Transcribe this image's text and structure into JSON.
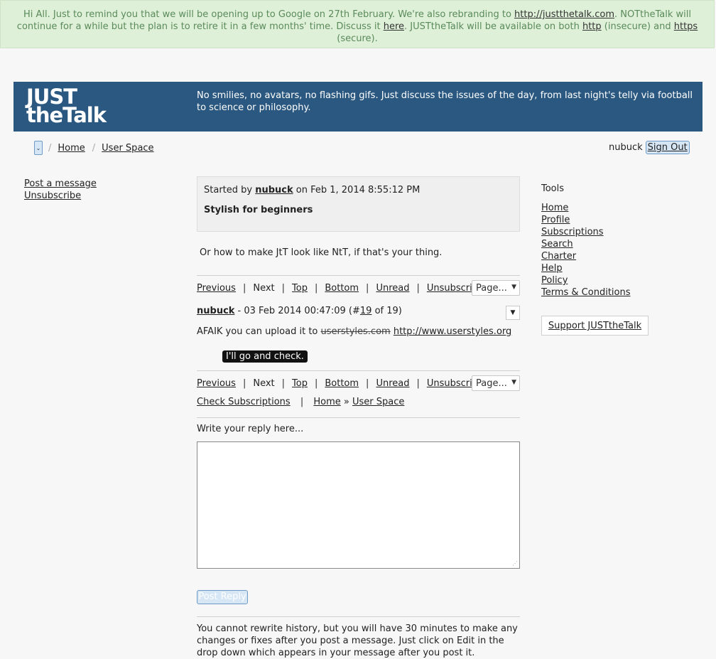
{
  "notice": {
    "text1": "Hi All. Just to remind you that we will be opening up to Google on 27th February. We're also rebranding to ",
    "link1": "http://justthetalk.com",
    "text2": ". NOTtheTalk will continue for a while but the plan is to retire it in a few months' time. Discuss it ",
    "link2": "here",
    "text3": ". JUSTtheTalk will be available on both ",
    "link3": "http",
    "text4": " (insecure) and ",
    "link4": "https",
    "text5": " (secure)."
  },
  "banner": {
    "logo_line1": "JUST",
    "logo_line2": "theTalk",
    "tagline": "No smilies, no avatars, no flashing gifs. Just discuss the issues of the day, from last night's telly via football to science or philosophy."
  },
  "breadcrumb": {
    "toggle": "⌄",
    "sep": "/",
    "home": "Home",
    "user_space": "User Space"
  },
  "user": {
    "name": "nubuck",
    "sign_out": "Sign Out"
  },
  "left_links": {
    "post_message": "Post a message",
    "unsubscribe": "Unsubscribe"
  },
  "thread": {
    "started_by": "Started by ",
    "author": "nubuck",
    "started_on": " on Feb 1, 2014 8:55:12 PM",
    "title": "Stylish for beginners",
    "intro": "Or how to make JtT look like NtT, if that's your thing."
  },
  "nav": {
    "previous": "Previous",
    "next": "Next",
    "top": "Top",
    "bottom": "Bottom",
    "unread": "Unread",
    "unsubscribe": "Unsubscribe",
    "page_select": "Page...",
    "sep": "|"
  },
  "post": {
    "author": "nubuck",
    "meta_prefix": " - 03 Feb 2014 00:47:09 (#",
    "number": "19",
    "meta_suffix": " of 19)",
    "body_prefix": "AFAIK you can upload it to ",
    "strike_text": "userstyles.com",
    "link": "http://www.userstyles.org",
    "tooltip": "I'll go and check."
  },
  "footer_links": {
    "check_subscriptions": "Check Subscriptions",
    "sep": "|",
    "home": "Home",
    "arrow": "»",
    "user_space": "User Space"
  },
  "reply": {
    "label": "Write your reply here...",
    "button": "Post Reply",
    "note": "You cannot rewrite history, but you will have 30 minutes to make any changes or fixes after you post a message. Just click on Edit in the drop down which appears in your message after you post it."
  },
  "tools": {
    "title": "Tools",
    "items": [
      "Home",
      "Profile",
      "Subscriptions",
      "Search",
      "Charter",
      "Help",
      "Policy",
      "Terms & Conditions"
    ],
    "support": "Support JUSTtheTalk"
  },
  "colors": {
    "banner": "#2b5880",
    "notice_bg": "#dff0d8",
    "button_bg": "#d6e6f5"
  }
}
